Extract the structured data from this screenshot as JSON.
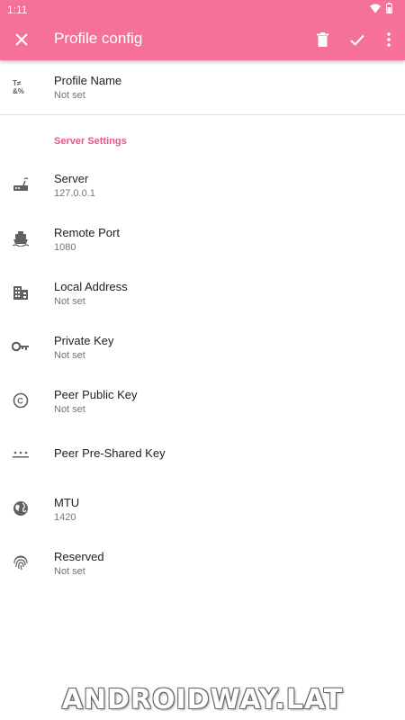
{
  "status_bar": {
    "time": "1:11"
  },
  "toolbar": {
    "title": "Profile config"
  },
  "profile": {
    "title": "Profile Name",
    "summary": "Not set"
  },
  "category": {
    "label": "Server Settings"
  },
  "items": [
    {
      "title": "Server",
      "summary": "127.0.0.1",
      "icon": "router-icon"
    },
    {
      "title": "Remote Port",
      "summary": "1080",
      "icon": "boat-icon"
    },
    {
      "title": "Local Address",
      "summary": "Not set",
      "icon": "building-icon"
    },
    {
      "title": "Private Key",
      "summary": "Not set",
      "icon": "key-icon"
    },
    {
      "title": "Peer Public Key",
      "summary": "Not set",
      "icon": "copyright-icon"
    },
    {
      "title": "Peer Pre-Shared Key",
      "summary": "",
      "icon": "password-dots-icon"
    },
    {
      "title": "MTU",
      "summary": "1420",
      "icon": "globe-icon"
    },
    {
      "title": "Reserved",
      "summary": "Not set",
      "icon": "fingerprint-icon"
    }
  ],
  "watermark": "ANDROIDWAY.LAT",
  "colors": {
    "appbar": "#f57198",
    "accent": "#e8577f",
    "icon": "#616161"
  }
}
